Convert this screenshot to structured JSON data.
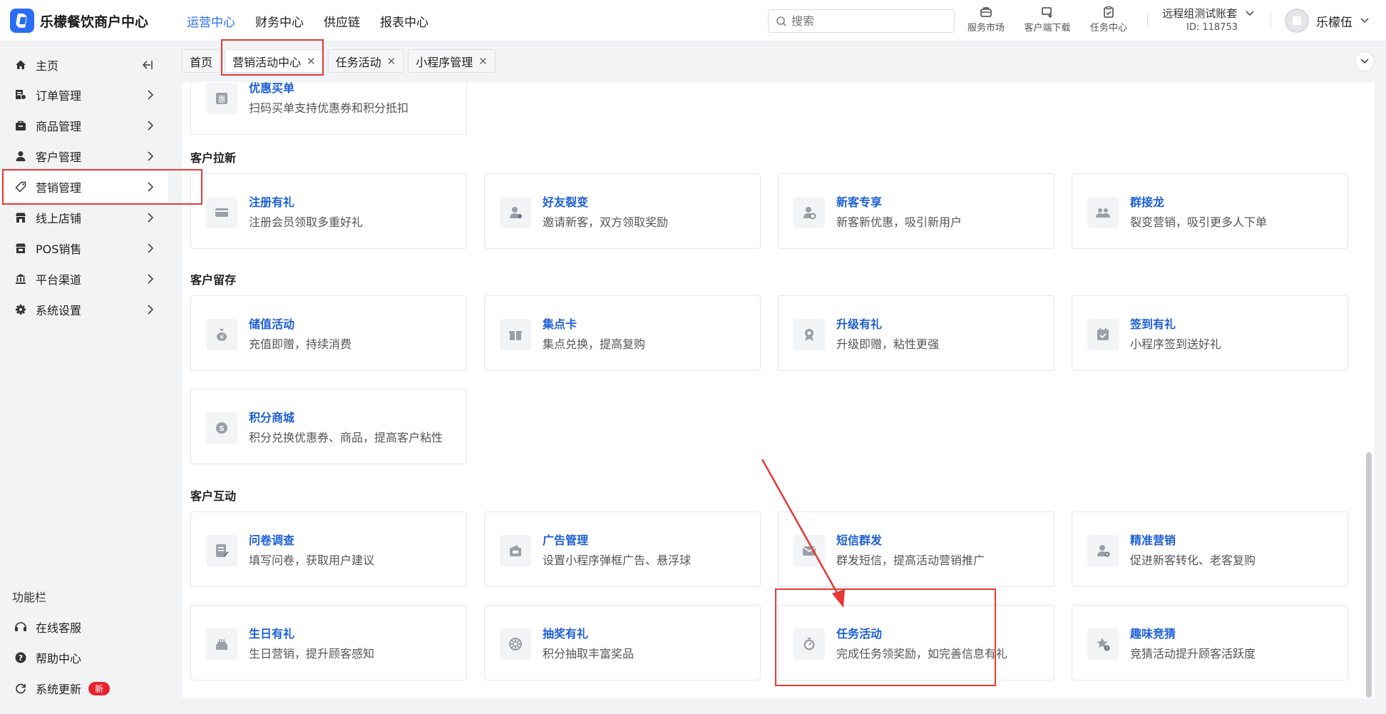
{
  "app": {
    "name": "乐檬餐饮商户中心"
  },
  "topnav": [
    "运营中心",
    "财务中心",
    "供应链",
    "报表中心"
  ],
  "search": {
    "placeholder": "搜索"
  },
  "tools": [
    "服务市场",
    "客户端下载",
    "任务中心"
  ],
  "account": {
    "name": "远程组测试账套",
    "id": "ID: 118753"
  },
  "user": {
    "name": "乐檬伍"
  },
  "sidebar": {
    "items": [
      {
        "label": "主页",
        "icon": "home-icon"
      },
      {
        "label": "订单管理",
        "icon": "order-icon"
      },
      {
        "label": "商品管理",
        "icon": "goods-icon"
      },
      {
        "label": "客户管理",
        "icon": "user-icon"
      },
      {
        "label": "营销管理",
        "icon": "tag-icon"
      },
      {
        "label": "线上店铺",
        "icon": "store-icon"
      },
      {
        "label": "POS销售",
        "icon": "pos-icon"
      },
      {
        "label": "平台渠道",
        "icon": "bank-icon"
      },
      {
        "label": "系统设置",
        "icon": "gear-icon"
      }
    ],
    "func_title": "功能栏",
    "func_items": [
      {
        "label": "在线客服",
        "icon": "headset-icon"
      },
      {
        "label": "帮助中心",
        "icon": "help-icon"
      },
      {
        "label": "系统更新",
        "icon": "refresh-icon",
        "badge": "新"
      }
    ]
  },
  "tabs": [
    {
      "label": "首页",
      "closable": false
    },
    {
      "label": "营销活动中心",
      "closable": true
    },
    {
      "label": "任务活动",
      "closable": true
    },
    {
      "label": "小程序管理",
      "closable": true
    }
  ],
  "top_card": {
    "title": "优惠买单",
    "desc": "扫码买单支持优惠券和积分抵扣"
  },
  "sections": [
    {
      "title": "客户拉新",
      "cards": [
        {
          "title": "注册有礼",
          "desc": "注册会员领取多重好礼"
        },
        {
          "title": "好友裂变",
          "desc": "邀请新客，双方领取奖励"
        },
        {
          "title": "新客专享",
          "desc": "新客新优惠，吸引新用户"
        },
        {
          "title": "群接龙",
          "desc": "裂变营销，吸引更多人下单"
        }
      ]
    },
    {
      "title": "客户留存",
      "cards": [
        {
          "title": "储值活动",
          "desc": "充值即赠，持续消费"
        },
        {
          "title": "集点卡",
          "desc": "集点兑换，提高复购"
        },
        {
          "title": "升级有礼",
          "desc": "升级即赠，粘性更强"
        },
        {
          "title": "签到有礼",
          "desc": "小程序签到送好礼"
        },
        {
          "title": "积分商城",
          "desc": "积分兑换优惠券、商品，提高客户粘性"
        }
      ]
    },
    {
      "title": "客户互动",
      "cards": [
        {
          "title": "问卷调查",
          "desc": "填写问卷，获取用户建议"
        },
        {
          "title": "广告管理",
          "desc": "设置小程序弹框广告、悬浮球"
        },
        {
          "title": "短信群发",
          "desc": "群发短信，提高活动营销推广"
        },
        {
          "title": "精准营销",
          "desc": "促进新客转化、老客复购"
        },
        {
          "title": "生日有礼",
          "desc": "生日营销，提升顾客感知"
        },
        {
          "title": "抽奖有礼",
          "desc": "积分抽取丰富奖品"
        },
        {
          "title": "任务活动",
          "desc": "完成任务领奖励，如完善信息有礼"
        },
        {
          "title": "趣味竞猜",
          "desc": "竞猜活动提升顾客活跃度"
        }
      ]
    }
  ],
  "colors": {
    "accent": "#2a6df5",
    "link": "#1d5fd6",
    "highlight": "#e53935",
    "badge": "#e8212c"
  }
}
